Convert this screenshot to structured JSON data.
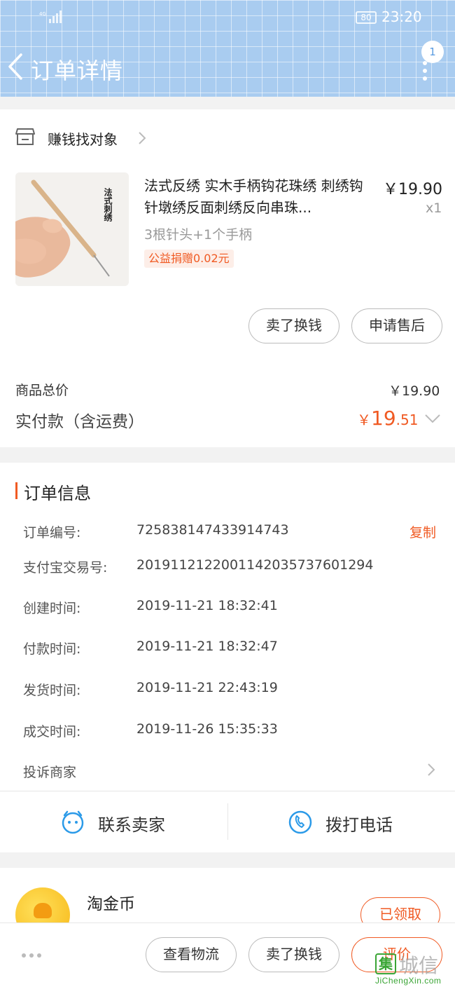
{
  "status_bar": {
    "battery": "80",
    "time": "23:20"
  },
  "header": {
    "title": "订单详情",
    "badge_count": "1"
  },
  "shop": {
    "name": "赚钱找对象"
  },
  "product": {
    "title": "法式反绣 实木手柄钩花珠绣 刺绣钩针墩绣反面刺绣反向串珠...",
    "price": "￥19.90",
    "qty": "x1",
    "spec": "3根针头+1个手柄",
    "charity": "公益捐赠0.02元",
    "image_caption": "法式刺绣"
  },
  "item_actions": {
    "sell_label": "卖了换钱",
    "aftersale_label": "申请售后"
  },
  "summary": {
    "total_label": "商品总价",
    "total_value": "￥19.90",
    "paid_label": "实付款（含运费）",
    "paid_currency": "￥",
    "paid_int": "19",
    "paid_dec": ".51"
  },
  "order_info": {
    "title": "订单信息",
    "copy_label": "复制",
    "rows": [
      {
        "label": "订单编号:",
        "value": "725838147433914743"
      },
      {
        "label": "支付宝交易号:",
        "value": "2019112122001142035737601294"
      },
      {
        "label": "创建时间:",
        "value": "2019-11-21 18:32:41"
      },
      {
        "label": "付款时间:",
        "value": "2019-11-21 18:32:47"
      },
      {
        "label": "发货时间:",
        "value": "2019-11-21 22:43:19"
      },
      {
        "label": "成交时间:",
        "value": "2019-11-26 15:35:33"
      }
    ],
    "complaint_label": "投诉商家"
  },
  "contact": {
    "seller_label": "联系卖家",
    "call_label": "拨打电话"
  },
  "coins": {
    "label": "淘金币",
    "claimed_label": "已领取"
  },
  "bottom_bar": {
    "logistics_label": "查看物流",
    "sell_label": "卖了换钱",
    "review_label": "评价"
  },
  "watermark": {
    "char": "集",
    "text": "城信",
    "url": "JiChengXin.com"
  },
  "colors": {
    "accent": "#f05a23",
    "header_bg": "#a9ccf0",
    "link_blue": "#2b9ae8"
  }
}
